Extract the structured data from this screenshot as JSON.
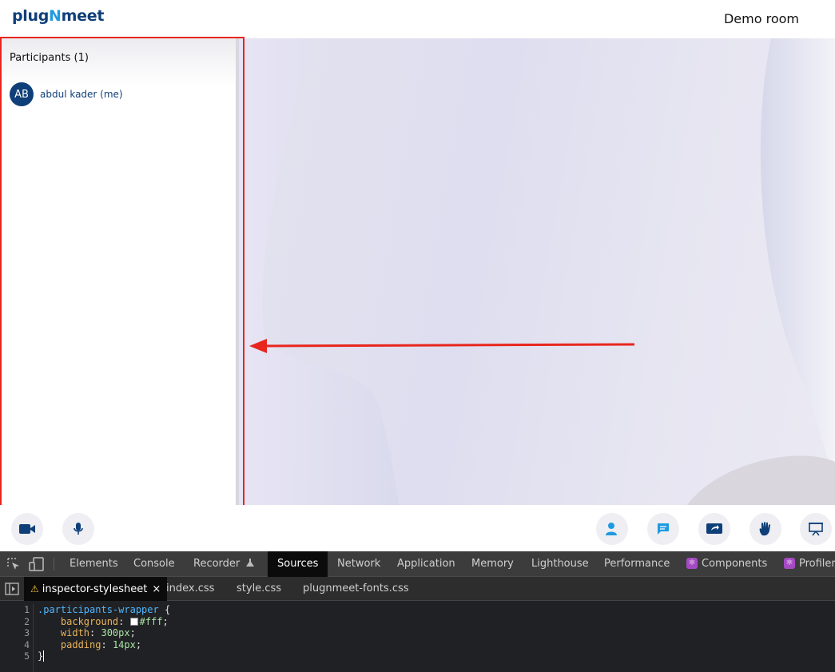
{
  "header": {
    "logo_part1": "plug",
    "logo_part2": "N",
    "logo_part3": "meet",
    "room_title": "Demo room"
  },
  "participants": {
    "title": "Participants (1)",
    "list": [
      {
        "initials": "AB",
        "name": "abdul kader (me)"
      }
    ]
  },
  "footer": {
    "left_controls": [
      "video-camera-icon",
      "microphone-icon"
    ],
    "right_controls": [
      "participants-icon",
      "chat-icon",
      "screen-share-icon",
      "raise-hand-icon",
      "whiteboard-icon"
    ]
  },
  "devtools": {
    "tabs": [
      "Elements",
      "Console",
      "Recorder",
      "Sources",
      "Network",
      "Application",
      "Memory",
      "Lighthouse",
      "Performance",
      "Components",
      "Profiler"
    ],
    "active_tab": "Sources",
    "files": [
      "inspector-stylesheet",
      "index.css",
      "style.css",
      "plugnmeet-fonts.css"
    ],
    "active_file": "inspector-stylesheet",
    "code": {
      "selector": ".participants-wrapper",
      "open_brace": " {",
      "close_brace": "}",
      "line_numbers": [
        "1",
        "2",
        "3",
        "4",
        "5"
      ],
      "declarations": [
        {
          "prop": "background",
          "value": "#fff"
        },
        {
          "prop": "width",
          "value": "300px"
        },
        {
          "prop": "padding",
          "value": "14px"
        }
      ]
    }
  },
  "colors": {
    "brand": "#0f3f78",
    "accent": "#1f9ae0",
    "annotation": "#e8261e"
  }
}
